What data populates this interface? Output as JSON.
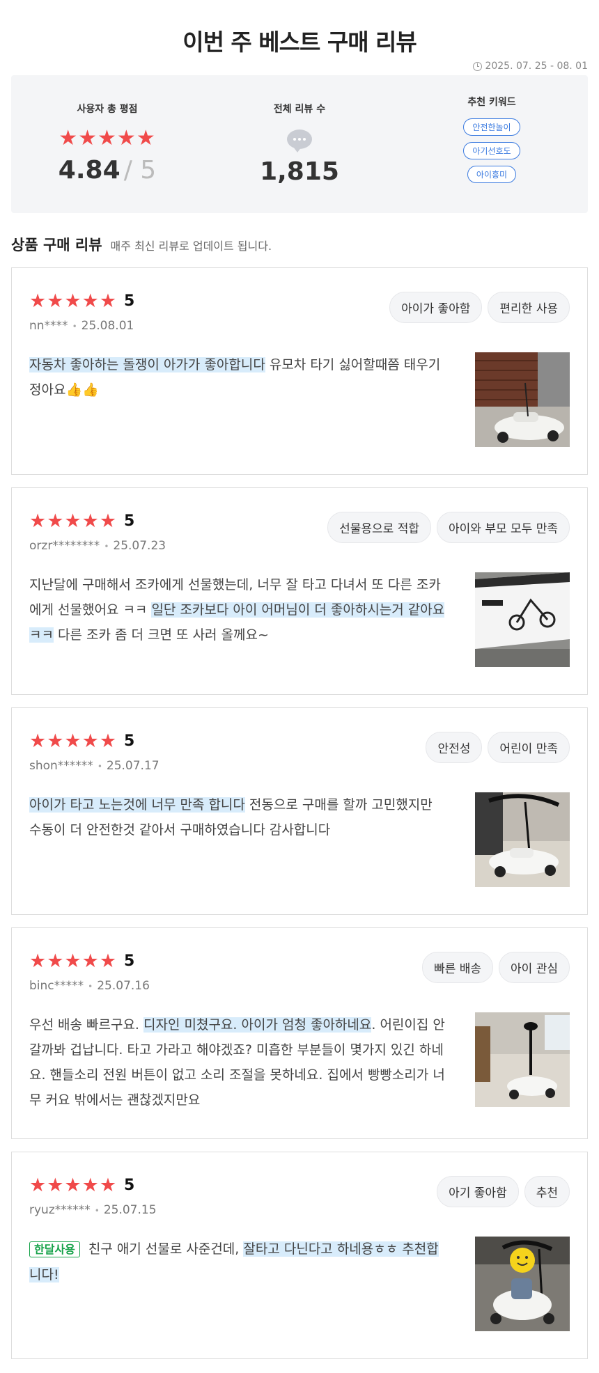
{
  "header": {
    "title": "이번 주 베스트 구매 리뷰",
    "period": "2025. 07. 25 - 08. 01"
  },
  "summary": {
    "rating_label": "사용자 총 평점",
    "rating_stars": "★★★★★",
    "rating_value": "4.84",
    "rating_max": "/ 5",
    "count_label": "전체 리뷰 수",
    "count_value": "1,815",
    "keyword_label": "추천 키워드",
    "keywords": [
      "안전한놀이",
      "아기선호도",
      "아이흥미"
    ]
  },
  "section": {
    "title": "상품 구매 리뷰",
    "subtitle": "매주 최신 리뷰로 업데이트 됩니다."
  },
  "reviews": [
    {
      "stars": "★★★★★",
      "score": "5",
      "user": "nn****",
      "date": "25.08.01",
      "tags": [
        "아이가 좋아함",
        "편리한 사용"
      ],
      "badge": "",
      "text_before": "",
      "text_highlight": "자동차 좋아하는 돌쟁이 아가가 좋아합니다",
      "text_after": " 유모차 타기 싫어할때쯤 태우기 정아요👍👍"
    },
    {
      "stars": "★★★★★",
      "score": "5",
      "user": "orzr********",
      "date": "25.07.23",
      "tags": [
        "선물용으로 적합",
        "아이와 부모 모두 만족"
      ],
      "badge": "",
      "text_before": "지난달에 구매해서 조카에게 선물했는데, 너무 잘 타고 다녀서 또 다른 조카에게 선물했어요 ㅋㅋ ",
      "text_highlight": "일단 조카보다 아이 어머님이 더 좋아하시는거 같아요ㅋㅋ",
      "text_after": " 다른 조카 좀 더 크면 또 사러 올께요~"
    },
    {
      "stars": "★★★★★",
      "score": "5",
      "user": "shon******",
      "date": "25.07.17",
      "tags": [
        "안전성",
        "어린이 만족"
      ],
      "badge": "",
      "text_before": "",
      "text_highlight": "아이가 타고 노는것에 너무 만족 합니다",
      "text_after": " 전동으로 구매를 할까 고민했지만 수동이 더 안전한것 같아서 구매하였습니다 감사합니다"
    },
    {
      "stars": "★★★★★",
      "score": "5",
      "user": "binc*****",
      "date": "25.07.16",
      "tags": [
        "빠른 배송",
        "아이 관심"
      ],
      "badge": "",
      "text_before": "우선 배송 빠르구요. ",
      "text_highlight": "디자인 미쳤구요. 아이가 엄청 좋아하네요",
      "text_after": ". 어린이집 안갈까봐 겁납니다. 타고 가라고 해야겠죠? 미흡한 부분들이 몇가지 있긴 하네요. 핸들소리 전원 버튼이 없고 소리 조절을 못하네요. 집에서 빵빵소리가 너무 커요 밖에서는 괜찮겠지만요"
    },
    {
      "stars": "★★★★★",
      "score": "5",
      "user": "ryuz******",
      "date": "25.07.15",
      "tags": [
        "아기 좋아함",
        "추천"
      ],
      "badge": "한달사용",
      "text_before": "친구 애기 선물로 사준건데, ",
      "text_highlight": "잘타고 다닌다고 하네용ㅎㅎ 추천합니다!",
      "text_after": ""
    }
  ],
  "colors": {
    "star": "#f04a4a",
    "keyword": "#3b7be0",
    "highlight": "#d8ecfb",
    "badge": "#17a34a"
  }
}
